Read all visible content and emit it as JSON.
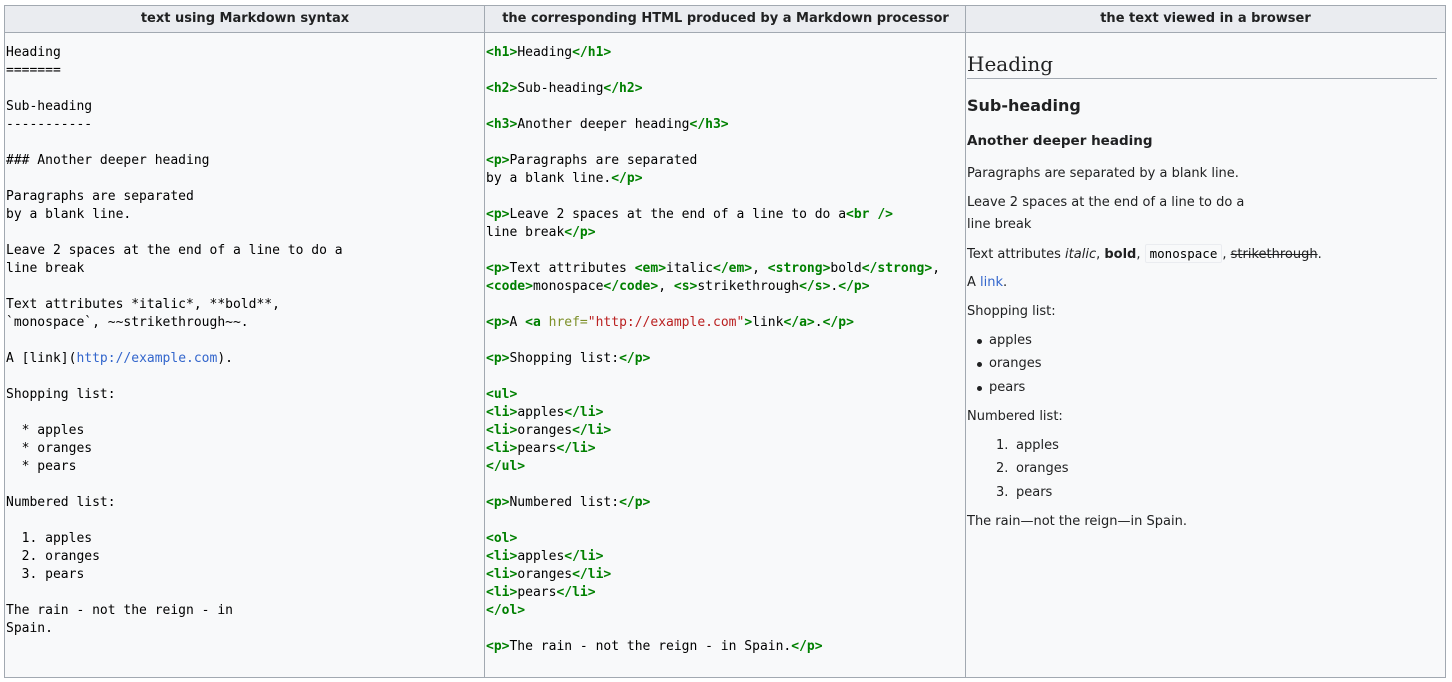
{
  "headers": {
    "col1": "text using Markdown syntax",
    "col2": "the corresponding HTML produced by a Markdown processor",
    "col3": "the text viewed in a browser"
  },
  "markdown": {
    "l1": "Heading",
    "l2": "=======",
    "l3": "Sub-heading",
    "l4": "-----------",
    "l5": "### Another deeper heading",
    "l6": "Paragraphs are separated",
    "l7": "by a blank line.",
    "l8": "Leave 2 spaces at the end of a line to do a",
    "l9": "line break",
    "l10": "Text attributes *italic*, **bold**,",
    "l11": "`monospace`, ~~strikethrough~~.",
    "l12_pre": "A [link](",
    "l12_url": "http://example.com",
    "l12_post": ").",
    "l13": "Shopping list:",
    "l14": "  * apples",
    "l15": "  * oranges",
    "l16": "  * pears",
    "l17": "Numbered list:",
    "l18": "  1. apples",
    "l19": "  2. oranges",
    "l20": "  3. pears",
    "l21": "The rain - not the reign - in",
    "l22": "Spain."
  },
  "html_code": {
    "h1_open": "<h1>",
    "h1_text": "Heading",
    "h1_close": "</h1>",
    "h2_open": "<h2>",
    "h2_text": "Sub-heading",
    "h2_close": "</h2>",
    "h3_open": "<h3>",
    "h3_text": "Another deeper heading",
    "h3_close": "</h3>",
    "p_open": "<p>",
    "p_close": "</p>",
    "p1a": "Paragraphs are separated",
    "p1b": "by a blank line.",
    "p2a": "Leave 2 spaces at the end of a line to do a",
    "br": "<br />",
    "p2b": "line break",
    "p3a": "Text attributes ",
    "em_open": "<em>",
    "em_text": "italic",
    "em_close": "</em>",
    "comma": ", ",
    "strong_open": "<strong>",
    "strong_text": "bold",
    "strong_close": "</strong>",
    "code_open": "<code>",
    "code_text": "monospace",
    "code_close": "</code>",
    "s_open": "<s>",
    "s_text": "strikethrough",
    "s_close": "</s>",
    "period": ".",
    "p4a": "A ",
    "a_open": "<a",
    "a_attr": " href=",
    "a_val": "\"http://example.com\"",
    "a_gt": ">",
    "a_text": "link",
    "a_close": "</a>",
    "p5": "Shopping list:",
    "ul_open": "<ul>",
    "ul_close": "</ul>",
    "li_open": "<li>",
    "li_close": "</li>",
    "li1": "apples",
    "li2": "oranges",
    "li3": "pears",
    "p6": "Numbered list:",
    "ol_open": "<ol>",
    "ol_close": "</ol>",
    "p7": "The rain - not the reign - in Spain."
  },
  "rendered": {
    "h1": "Heading",
    "h2": "Sub-heading",
    "h3": "Another deeper heading",
    "p1": "Paragraphs are separated by a blank line.",
    "p2a": "Leave 2 spaces at the end of a line to do a",
    "p2b": "line break",
    "p3_pre": "Text attributes ",
    "p3_italic": "italic",
    "p3_comma1": ", ",
    "p3_bold": "bold",
    "p3_comma2": ", ",
    "p3_mono": "monospace",
    "p3_comma3": ", ",
    "p3_strike": "strikethrough",
    "p3_end": ".",
    "p4_pre": "A ",
    "p4_link": "link",
    "p4_end": ".",
    "shopping_label": "Shopping list:",
    "shopping_items": [
      "apples",
      "oranges",
      "pears"
    ],
    "numbered_label": "Numbered list:",
    "numbered_markers": [
      "1.",
      "2.",
      "3."
    ],
    "numbered_items": [
      "apples",
      "oranges",
      "pears"
    ],
    "final": "The rain—not the reign—in Spain."
  },
  "colors": {
    "tag": "#008000",
    "attribute": "#7d9029",
    "string": "#ba2121",
    "link": "#3366cc",
    "header_bg": "#eaecf0",
    "cell_bg": "#f8f9fa",
    "border": "#a2a9b1"
  }
}
